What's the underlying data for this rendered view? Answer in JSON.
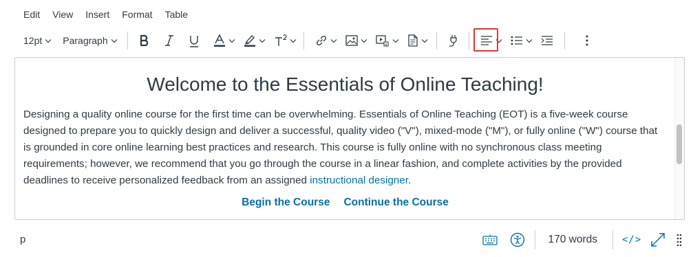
{
  "menubar": {
    "items": [
      "Edit",
      "View",
      "Insert",
      "Format",
      "Table"
    ]
  },
  "toolbar": {
    "font_size": "12pt",
    "block_format": "Paragraph",
    "highlighted_tool": "apps-plug-icon",
    "highlight_color": "#e0362f"
  },
  "content": {
    "heading": "Welcome to the Essentials of Online Teaching!",
    "paragraph_text": "Designing a quality online course for the first time can be overwhelming. Essentials of Online Teaching (EOT) is a five-week course designed to prepare you to quickly design and deliver a successful, quality video (\"V\"), mixed-mode (\"M\"), or fully online (\"W\") course that is grounded in core online learning best practices and research. This course is fully online with no synchronous class meeting requirements; however, we recommend that you go through the course in a linear fashion, and complete activities by the provided deadlines to receive personalized feedback from an assigned ",
    "paragraph_link": "instructional designer",
    "paragraph_end": ".",
    "cta_begin": "Begin the Course",
    "cta_continue": "Continue the Course",
    "link_color": "#0770a3"
  },
  "statusbar": {
    "path": "p",
    "word_count": "170 words",
    "html_toggle": "</>"
  }
}
